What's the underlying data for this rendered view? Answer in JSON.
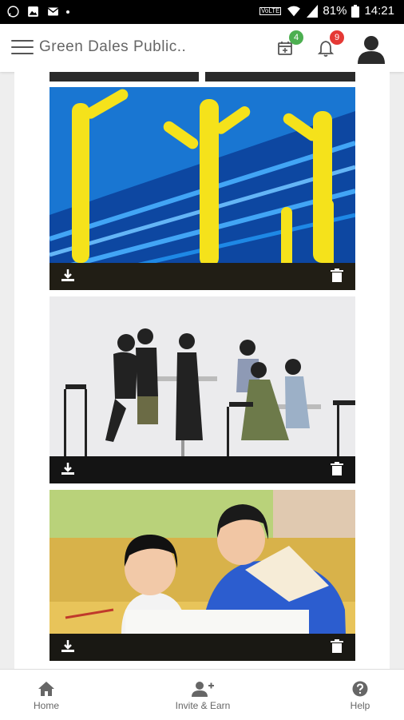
{
  "status_bar": {
    "battery": "81%",
    "time": "14:21",
    "network": "VoLTE"
  },
  "app_bar": {
    "title": "Green Dales Public..",
    "calendar_badge": "4",
    "notification_badge": "9"
  },
  "gallery": {
    "items": [
      {
        "photo_icon": "yellow-tube-sculptures-photo"
      },
      {
        "photo_icon": "people-at-table-photo"
      },
      {
        "photo_icon": "children-reading-photo"
      }
    ]
  },
  "bottom_nav": {
    "items": [
      {
        "label": "Home",
        "icon": "home-icon"
      },
      {
        "label": "Invite & Earn",
        "icon": "add-user-icon"
      },
      {
        "label": "Help",
        "icon": "help-icon"
      }
    ]
  },
  "colors": {
    "badge_green": "#4caf50",
    "badge_red": "#e53935",
    "status_bar": "#000000",
    "photo_blue": "#1565c0",
    "photo_yellow": "#f5e21b"
  }
}
